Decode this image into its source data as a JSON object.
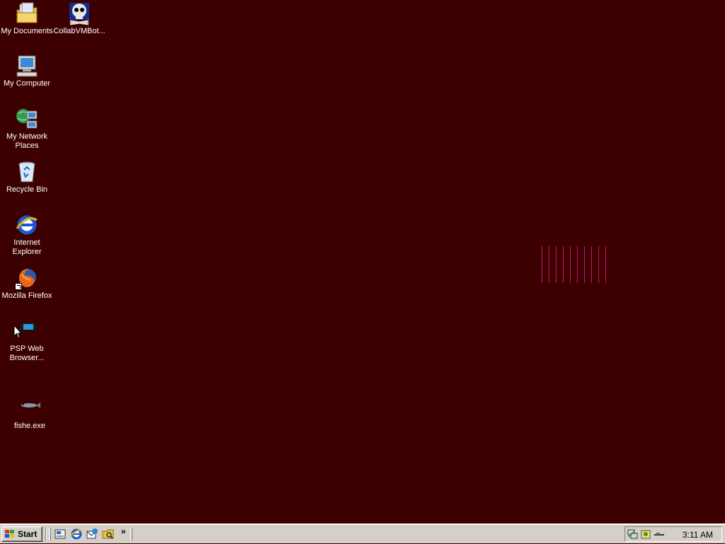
{
  "desktop": {
    "background_color": "#3d0000",
    "icons": [
      {
        "label": "My Documents",
        "icon": "folder-documents-icon"
      },
      {
        "label": "CollabVMBot...",
        "icon": "skull-icon"
      },
      {
        "label": "My Computer",
        "icon": "computer-icon"
      },
      {
        "label": "My Network Places",
        "icon": "network-places-icon"
      },
      {
        "label": "Recycle Bin",
        "icon": "recycle-bin-icon"
      },
      {
        "label": "Internet Explorer",
        "icon": "internet-explorer-icon"
      },
      {
        "label": "Mozilla Firefox",
        "icon": "firefox-icon"
      },
      {
        "label": "PSP Web Browser...",
        "icon": "psp-icon"
      },
      {
        "label": "fishe.exe",
        "icon": "fish-icon"
      }
    ],
    "screensaver_line_color": "#c8127a"
  },
  "taskbar": {
    "start_label": "Start",
    "quick_launch": [
      {
        "name": "show-desktop-icon"
      },
      {
        "name": "internet-explorer-icon"
      },
      {
        "name": "outlook-express-icon"
      },
      {
        "name": "windows-explorer-icon"
      }
    ],
    "more_label": "»",
    "tray_icons": [
      "network-icon",
      "update-icon",
      "usb-icon"
    ],
    "clock": "3:11 AM"
  }
}
